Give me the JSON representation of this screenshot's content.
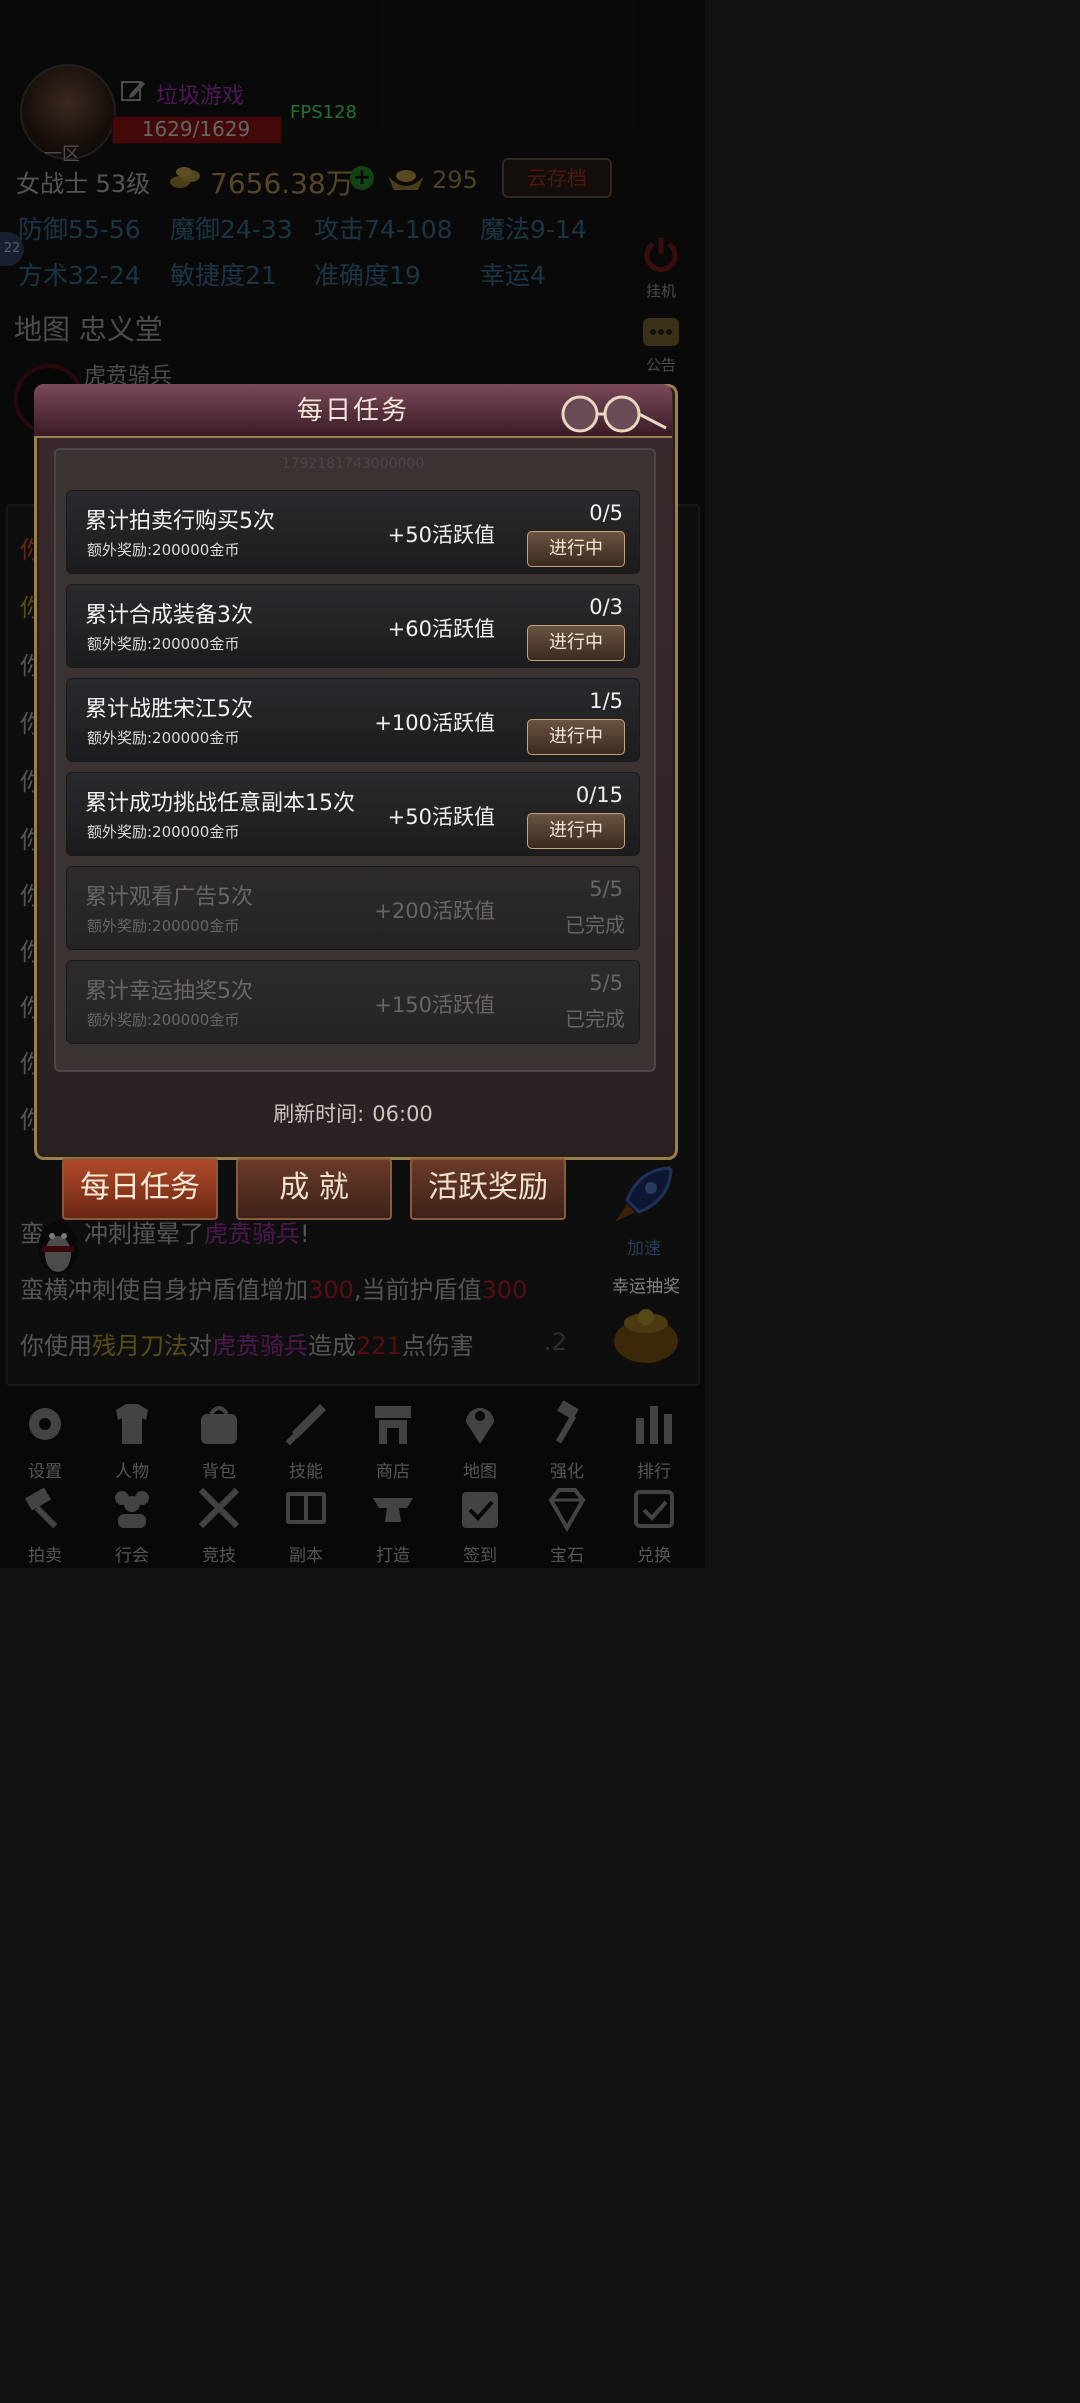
{
  "player": {
    "server": "一区",
    "name": "垃圾游戏",
    "hp": "1629/1629",
    "fps": "FPS128",
    "class_level": "女战士 53级",
    "gold": "7656.38万",
    "ingot": "295",
    "cloud_save": "云存档",
    "side_badge": "22"
  },
  "stats": [
    "防御55-56",
    "魔御24-33",
    "攻击74-108",
    "魔法9-14",
    "方术32-24",
    "敏捷度21",
    "准确度19",
    "幸运4"
  ],
  "side_buttons": {
    "idle": "挂机",
    "notice": "公告",
    "speed": "加速",
    "lucky": "幸运抽奖",
    "ghost_num": ".2"
  },
  "map": "地图 忠义堂",
  "enemy": "虎贲骑兵",
  "log": {
    "line1_a": "蛮",
    "line1_b": "冲刺撞晕了",
    "line1_c": "虎贲骑兵",
    "line2_a": "蛮横冲刺使自身护盾值增加",
    "line2_b": "300",
    "line2_c": ",当前护盾值",
    "line2_d": "300",
    "line3_a": "你使用",
    "line3_b": "残月刀法",
    "line3_c": "对",
    "line3_d": "虎贲骑兵",
    "line3_e": "造成",
    "line3_f": "221",
    "line3_g": "点伤害",
    "partial": [
      "你",
      "你",
      "你",
      "你",
      "你",
      "你",
      "你",
      "你",
      "你",
      "你",
      "你"
    ]
  },
  "modal": {
    "title": "每日任务",
    "ghost_text": "1792181743000000",
    "refresh_label": "刷新时间:",
    "refresh_time": "06:00",
    "tasks": [
      {
        "name": "累计拍卖行购买5次",
        "bonus": "额外奖励:200000金币",
        "reward": "+50活跃值",
        "progress": "0/5",
        "status": "进行中"
      },
      {
        "name": "累计合成装备3次",
        "bonus": "额外奖励:200000金币",
        "reward": "+60活跃值",
        "progress": "0/3",
        "status": "进行中"
      },
      {
        "name": "累计战胜宋江5次",
        "bonus": "额外奖励:200000金币",
        "reward": "+100活跃值",
        "progress": "1/5",
        "status": "进行中"
      },
      {
        "name": "累计成功挑战任意副本15次",
        "bonus": "额外奖励:200000金币",
        "reward": "+50活跃值",
        "progress": "0/15",
        "status": "进行中"
      },
      {
        "name": "累计观看广告5次",
        "bonus": "额外奖励:200000金币",
        "reward": "+200活跃值",
        "progress": "5/5",
        "status": "已完成"
      },
      {
        "name": "累计幸运抽奖5次",
        "bonus": "额外奖励:200000金币",
        "reward": "+150活跃值",
        "progress": "5/5",
        "status": "已完成"
      }
    ]
  },
  "tabs": [
    "每日任务",
    "成 就",
    "活跃奖励"
  ],
  "nav_row1": [
    "设置",
    "人物",
    "背包",
    "技能",
    "商店",
    "地图",
    "强化",
    "排行"
  ],
  "nav_row2": [
    "拍卖",
    "行会",
    "竞技",
    "副本",
    "打造",
    "签到",
    "宝石",
    "兑换"
  ]
}
